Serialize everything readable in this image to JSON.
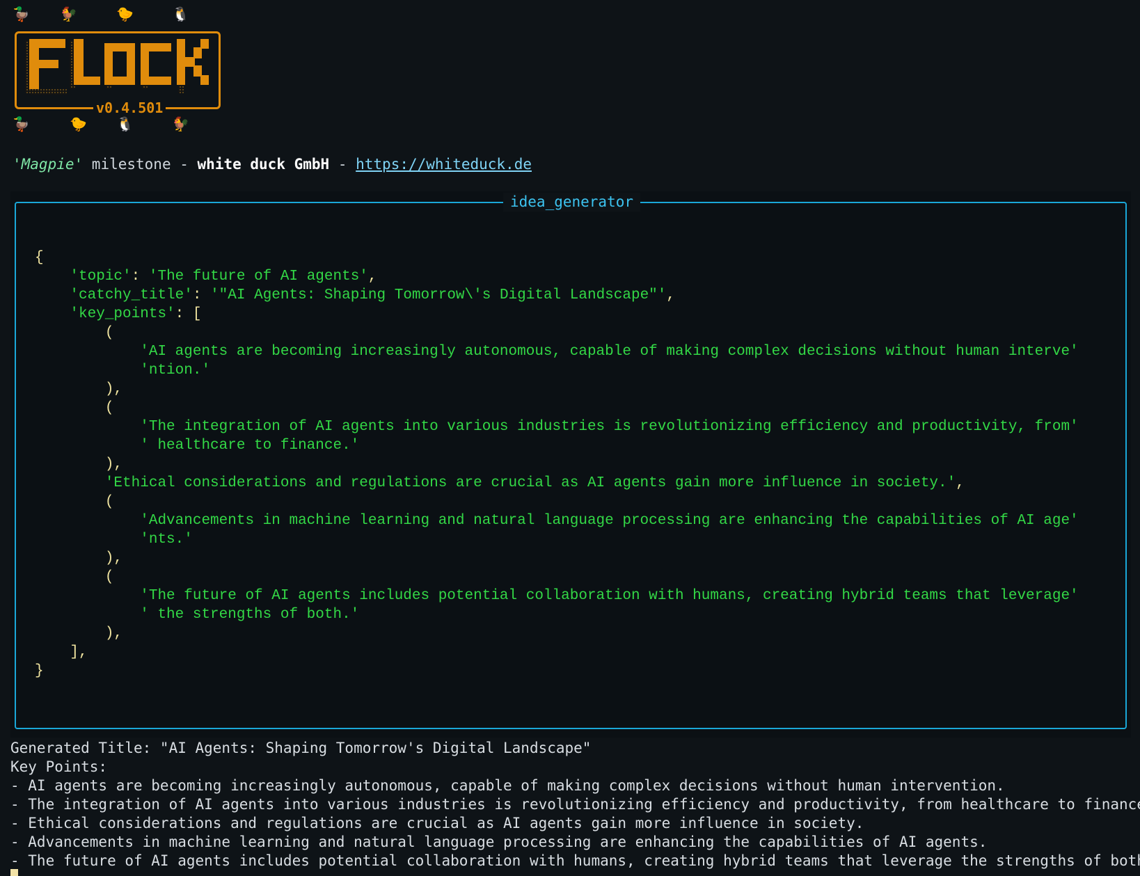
{
  "header": {
    "top_animals": [
      "🦆",
      "🐓",
      "🐤",
      "🐧"
    ],
    "bottom_animals": [
      "🦆",
      "🐤",
      "🐧",
      "🐓"
    ],
    "logo_text": "FLOCK",
    "version": "v0.4.501",
    "logo_color": "#e08c0c"
  },
  "tagline": {
    "milestone": "'Magpie'",
    "milestone_suffix": " milestone - ",
    "company": "white duck GmbH",
    "separator": " - ",
    "url": "https://whiteduck.de"
  },
  "panel": {
    "title": "idea_generator",
    "border_color": "#1aa7d8",
    "lines": [
      [
        {
          "t": "p",
          "v": "{"
        }
      ],
      [
        {
          "t": "p",
          "v": "    "
        },
        {
          "t": "k",
          "v": "'topic'"
        },
        {
          "t": "p",
          "v": ": "
        },
        {
          "t": "s",
          "v": "'The future of AI agents'"
        },
        {
          "t": "p",
          "v": ","
        }
      ],
      [
        {
          "t": "p",
          "v": "    "
        },
        {
          "t": "k",
          "v": "'catchy_title'"
        },
        {
          "t": "p",
          "v": ": "
        },
        {
          "t": "s",
          "v": "'\"AI Agents: Shaping Tomorrow\\'s Digital Landscape\"'"
        },
        {
          "t": "p",
          "v": ","
        }
      ],
      [
        {
          "t": "p",
          "v": "    "
        },
        {
          "t": "k",
          "v": "'key_points'"
        },
        {
          "t": "p",
          "v": ": ["
        }
      ],
      [
        {
          "t": "p",
          "v": "        ("
        }
      ],
      [
        {
          "t": "p",
          "v": "            "
        },
        {
          "t": "s",
          "v": "'AI agents are becoming increasingly autonomous, capable of making complex decisions without human interve'"
        }
      ],
      [
        {
          "t": "p",
          "v": "            "
        },
        {
          "t": "s",
          "v": "'ntion.'"
        }
      ],
      [
        {
          "t": "p",
          "v": "        ),"
        }
      ],
      [
        {
          "t": "p",
          "v": "        ("
        }
      ],
      [
        {
          "t": "p",
          "v": "            "
        },
        {
          "t": "s",
          "v": "'The integration of AI agents into various industries is revolutionizing efficiency and productivity, from'"
        }
      ],
      [
        {
          "t": "p",
          "v": "            "
        },
        {
          "t": "s",
          "v": "' healthcare to finance.'"
        }
      ],
      [
        {
          "t": "p",
          "v": "        ),"
        }
      ],
      [
        {
          "t": "p",
          "v": "        "
        },
        {
          "t": "s",
          "v": "'Ethical considerations and regulations are crucial as AI agents gain more influence in society.'"
        },
        {
          "t": "p",
          "v": ","
        }
      ],
      [
        {
          "t": "p",
          "v": "        ("
        }
      ],
      [
        {
          "t": "p",
          "v": "            "
        },
        {
          "t": "s",
          "v": "'Advancements in machine learning and natural language processing are enhancing the capabilities of AI age'"
        }
      ],
      [
        {
          "t": "p",
          "v": "            "
        },
        {
          "t": "s",
          "v": "'nts.'"
        }
      ],
      [
        {
          "t": "p",
          "v": "        ),"
        }
      ],
      [
        {
          "t": "p",
          "v": "        ("
        }
      ],
      [
        {
          "t": "p",
          "v": "            "
        },
        {
          "t": "s",
          "v": "'The future of AI agents includes potential collaboration with humans, creating hybrid teams that leverage'"
        }
      ],
      [
        {
          "t": "p",
          "v": "            "
        },
        {
          "t": "s",
          "v": "' the strengths of both.'"
        }
      ],
      [
        {
          "t": "p",
          "v": "        ),"
        }
      ],
      [
        {
          "t": "p",
          "v": "    ],"
        }
      ],
      [
        {
          "t": "p",
          "v": "}"
        }
      ]
    ]
  },
  "output": {
    "lines": [
      "Generated Title: \"AI Agents: Shaping Tomorrow's Digital Landscape\"",
      "Key Points:",
      "- AI agents are becoming increasingly autonomous, capable of making complex decisions without human intervention.",
      "- The integration of AI agents into various industries is revolutionizing efficiency and productivity, from healthcare to finance.",
      "- Ethical considerations and regulations are crucial as AI agents gain more influence in society.",
      "- Advancements in machine learning and natural language processing are enhancing the capabilities of AI agents.",
      "- The future of AI agents includes potential collaboration with humans, creating hybrid teams that leverage the strengths of both."
    ]
  }
}
